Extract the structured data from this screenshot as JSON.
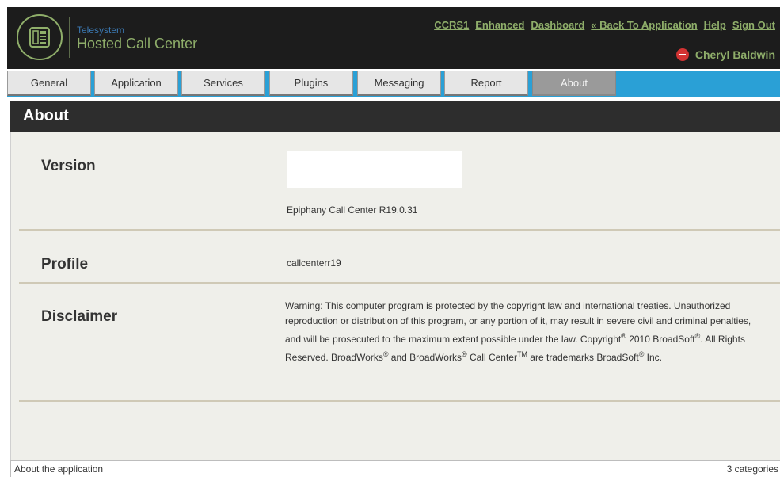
{
  "header": {
    "brand_small": "Telesystem",
    "brand_big": "Hosted Call Center",
    "links": {
      "ccrs1": "CCRS1",
      "enhanced": "Enhanced",
      "dashboard": "Dashboard",
      "back": "« Back To Application",
      "help": "Help",
      "signout": "Sign Out"
    },
    "user_name": "Cheryl Baldwin"
  },
  "tabs": {
    "general": "General",
    "application": "Application",
    "services": "Services",
    "plugins": "Plugins",
    "messaging": "Messaging",
    "report": "Report",
    "about": "About"
  },
  "page": {
    "title": "About"
  },
  "version": {
    "label": "Version",
    "value": "Epiphany Call Center R19.0.31"
  },
  "profile": {
    "label": "Profile",
    "value": "callcenterr19"
  },
  "disclaimer": {
    "label": "Disclaimer",
    "part1": "Warning: This computer program is protected by the copyright law and international treaties. Unauthorized reproduction or distribution of this program, or any portion of it, may result in severe civil and criminal penalties, and will be prosecuted to the maximum extent possible under the law. Copyright",
    "reg": "®",
    "part2": " 2010 BroadSoft",
    "part3": ". All Rights Reserved. BroadWorks",
    "part4": " and BroadWorks",
    "part5": " Call Center",
    "tm": "TM",
    "part6": " are trademarks BroadSoft",
    "part7": " Inc."
  },
  "status": {
    "left": "About the application",
    "right": "3 categories"
  },
  "colors": {
    "header_bg": "#1c1c1c",
    "brand_green": "#8fae6a",
    "tab_bar_blue": "#2aa0d6",
    "active_tab": "#9a9a9a",
    "content_bg": "#efefea"
  },
  "icons": {
    "logo": "phone-device-icon",
    "user": "user-status-icon"
  }
}
